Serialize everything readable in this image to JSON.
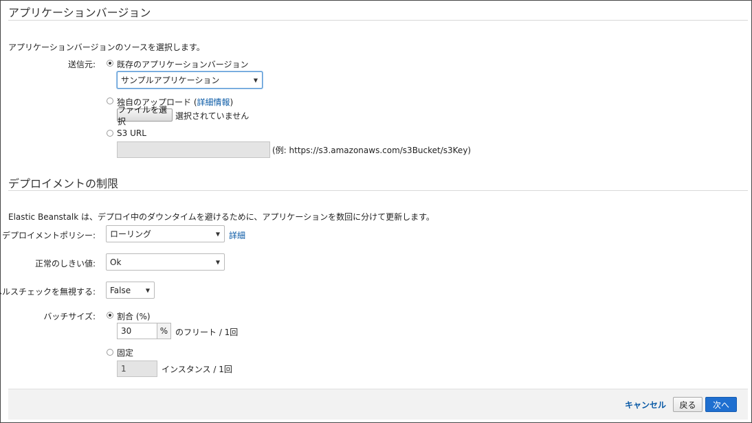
{
  "section1": {
    "title": "アプリケーションバージョン",
    "description": "アプリケーションバージョンのソースを選択します。",
    "source_label": "送信元:",
    "existing_label": "既存のアプリケーションバージョン",
    "existing_selected": true,
    "existing_select_value": "サンプルアプリケーション",
    "upload_label_prefix": "独自のアップロード (",
    "upload_link": "詳細情報",
    "upload_label_suffix": ")",
    "file_button": "ファイルを選択",
    "file_status": "選択されていません",
    "s3_label": "S3 URL",
    "s3_value": "",
    "s3_example": "(例: https://s3.amazonaws.com/s3Bucket/s3Key)"
  },
  "section2": {
    "title": "デプロイメントの制限",
    "description": "Elastic Beanstalk は、デプロイ中のダウンタイムを避けるために、アプリケーションを数回に分けて更新します。",
    "policy_label": "デプロイメントポリシー:",
    "policy_value": "ローリング",
    "policy_link": "詳細",
    "threshold_label": "正常のしきい値:",
    "threshold_value": "Ok",
    "ignore_health_label": "ヘルスチェックを無視する:",
    "ignore_health_value": "False",
    "batch_label": "バッチサイズ:",
    "percent_label": "割合 (%)",
    "percent_selected": true,
    "percent_value": "30",
    "percent_addon": "%",
    "percent_suffix": "のフリート / 1回",
    "fixed_label": "固定",
    "fixed_value": "1",
    "fixed_suffix": "インスタンス / 1回"
  },
  "footer": {
    "cancel": "キャンセル",
    "back": "戻る",
    "next": "次へ"
  }
}
